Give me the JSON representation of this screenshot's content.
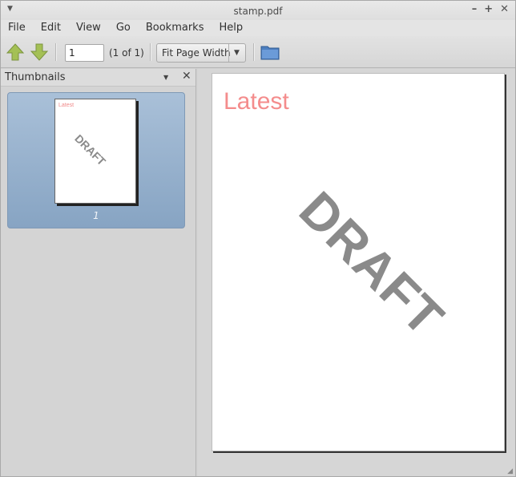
{
  "window": {
    "title": "stamp.pdf"
  },
  "menubar": {
    "items": [
      "File",
      "Edit",
      "View",
      "Go",
      "Bookmarks",
      "Help"
    ]
  },
  "toolbar": {
    "page_number": "1",
    "page_count": "(1 of 1)",
    "zoom_mode": "Fit Page Width"
  },
  "sidebar": {
    "title": "Thumbnails",
    "thumbnails": [
      {
        "label": "1"
      }
    ]
  },
  "document": {
    "text_top": "Latest",
    "stamp": "DRAFT",
    "colors": {
      "text_top": "#f48c8c",
      "stamp": "#8a8a8a"
    }
  },
  "colors": {
    "selection": "#9bb4cf",
    "toolbar_arrow": "#a4c055"
  }
}
